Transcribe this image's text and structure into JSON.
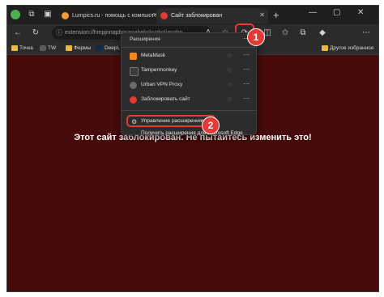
{
  "tabs": [
    {
      "label": "Lumpics.ru - помощь с компьют…",
      "active": false,
      "favicon_color": "#f39c33"
    },
    {
      "label": "Сайт заблокирован",
      "active": true,
      "favicon_color": "#e53935"
    }
  ],
  "toolbar": {
    "address": "extension://hmpjnnapbocaoahekckcphgliangbn…"
  },
  "bookmarks": [
    {
      "label": "Точка",
      "kind": "folder"
    },
    {
      "label": "TW",
      "kind": "site"
    },
    {
      "label": "Фермы",
      "kind": "folder"
    },
    {
      "label": "DeepL",
      "kind": "site"
    },
    {
      "label": "Другое избранное",
      "kind": "folder"
    }
  ],
  "extensions_menu": {
    "title": "Расширения",
    "items": [
      {
        "name": "MetaMask",
        "color": "#f6851b"
      },
      {
        "name": "Tampermonkey",
        "color": "#3a3a3a"
      },
      {
        "name": "Urban VPN Proxy",
        "color": "#6b6b6b"
      },
      {
        "name": "Заблокировать сайт",
        "color": "#e53935"
      }
    ],
    "manage_label": "Управление расширениями",
    "get_label": "Получить расширения для Microsoft Edge"
  },
  "page": {
    "message": "Этот сайт заблокирован. Не пытайтесь изменить это!",
    "background": "#470b0b"
  },
  "callouts": [
    "1",
    "2"
  ],
  "icons": [
    "avatar",
    "workspaces-icon",
    "tab-actions-icon",
    "back-icon",
    "refresh-icon",
    "info-icon",
    "read-aloud-icon",
    "favorite-star-icon",
    "extensions-icon",
    "split-screen-icon",
    "favorites-icon",
    "collections-icon",
    "copilot-icon",
    "more-icon",
    "eye-off-icon",
    "gear-icon"
  ]
}
